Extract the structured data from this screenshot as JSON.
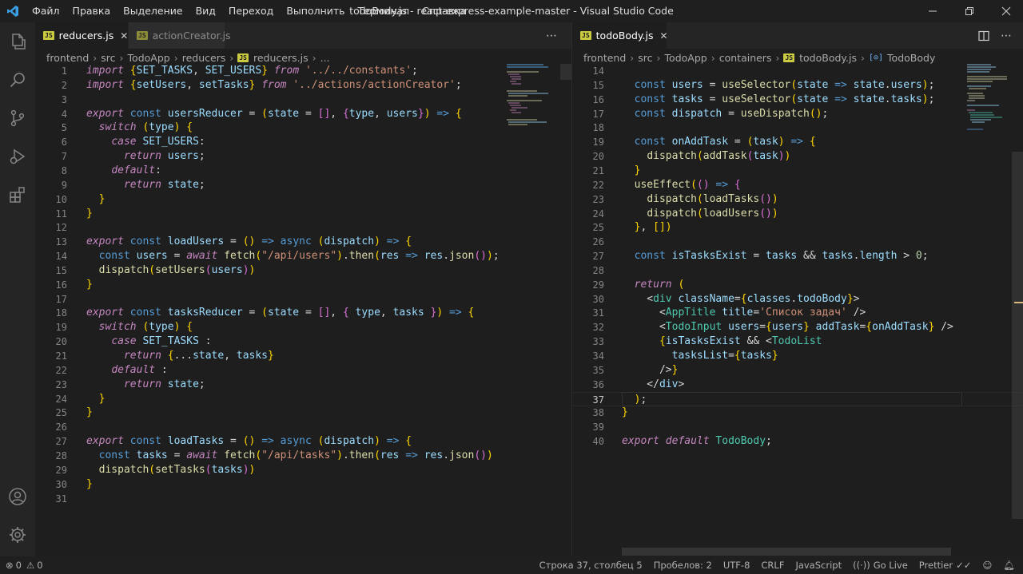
{
  "window": {
    "title": "todoBody.js - react-express-example-master - Visual Studio Code",
    "menu": [
      "Файл",
      "Правка",
      "Выделение",
      "Вид",
      "Переход",
      "Выполнить",
      "Терминал",
      "Справка"
    ]
  },
  "left_editor": {
    "tabs": [
      {
        "label": "reducers.js",
        "active": true
      },
      {
        "label": "actionCreator.js",
        "active": false
      }
    ],
    "breadcrumb": [
      "frontend",
      "src",
      "TodoApp",
      "reducers",
      "reducers.js",
      "..."
    ],
    "lines": [
      "import {SET_TASKS, SET_USERS} from '../../constants';",
      "import {setUsers, setTasks} from '../actions/actionCreator';",
      "",
      "export const usersReducer = (state = [], {type, users}) => {",
      "  switch (type) {",
      "    case SET_USERS:",
      "      return users;",
      "    default:",
      "      return state;",
      "  }",
      "}",
      "",
      "export const loadUsers = () => async (dispatch) => {",
      "  const users = await fetch(\"/api/users\").then(res => res.json());",
      "  dispatch(setUsers(users))",
      "}",
      "",
      "export const tasksReducer = (state = [], { type, tasks }) => {",
      "  switch (type) {",
      "    case SET_TASKS :",
      "      return {...state, tasks}",
      "    default :",
      "      return state;",
      "  }",
      "}",
      "",
      "export const loadTasks = () => async (dispatch) => {",
      "  const tasks = await fetch(\"/api/tasks\").then(res => res.json())",
      "  dispatch(setTasks(tasks))",
      "}",
      ""
    ]
  },
  "right_editor": {
    "tabs": [
      {
        "label": "todoBody.js",
        "active": true
      }
    ],
    "breadcrumb": [
      "frontend",
      "src",
      "TodoApp",
      "containers",
      "todoBody.js",
      "TodoBody"
    ],
    "first_line_number": 14,
    "current_line_number": 37,
    "lines": [
      "",
      "  const users = useSelector(state => state.users);",
      "  const tasks = useSelector(state => state.tasks);",
      "  const dispatch = useDispatch();",
      "",
      "  const onAddTask = (task) => {",
      "    dispatch(addTask(task))",
      "  }",
      "  useEffect(() => {",
      "    dispatch(loadTasks())",
      "    dispatch(loadUsers())",
      "  }, [])",
      "",
      "  const isTasksExist = tasks && tasks.length > 0;",
      "",
      "  return (",
      "    <div className={classes.todoBody}>",
      "      <AppTitle title='Список задач' />",
      "      <TodoInput users={users} addTask={onAddTask} />",
      "      {isTasksExist && <TodoList",
      "        tasksList={tasks}",
      "      />}",
      "    </div>",
      "  );",
      "}",
      "",
      "export default TodoBody;"
    ]
  },
  "statusbar": {
    "errors": "0",
    "warnings": "0",
    "position": "Строка 37, столбец 5",
    "indent": "Пробелов: 2",
    "encoding": "UTF-8",
    "eol": "CRLF",
    "language": "JavaScript",
    "golive": "Go Live",
    "prettier": "Prettier"
  },
  "icons": {
    "activity": [
      "files-icon",
      "search-icon",
      "source-control-icon",
      "run-debug-icon",
      "extensions-icon",
      "account-icon",
      "settings-gear-icon"
    ]
  },
  "colors": {
    "accent": "#007acc",
    "editor_bg": "#1e1e1e",
    "titlebar_bg": "#1f1f1f"
  }
}
